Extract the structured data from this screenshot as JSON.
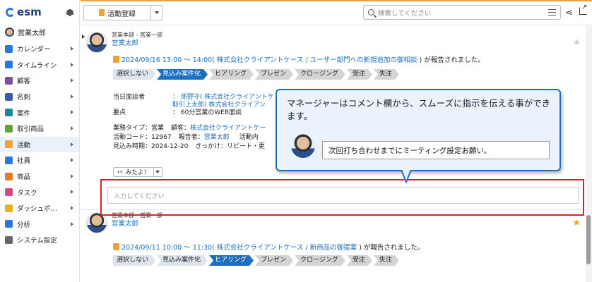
{
  "app": {
    "logo_text": "esm"
  },
  "user": {
    "name": "営業太郎"
  },
  "sidebar": {
    "items": [
      {
        "label": "カレンダー",
        "color": "#2a7ad5",
        "icon": "calendar-icon",
        "arrow": true
      },
      {
        "label": "タイムライン",
        "color": "#2a7ad5",
        "icon": "timeline-icon",
        "arrow": true
      },
      {
        "label": "顧客",
        "color": "#7b4fa0",
        "icon": "building-icon",
        "arrow": true
      },
      {
        "label": "名刺",
        "color": "#3b5aa8",
        "icon": "card-icon",
        "arrow": true
      },
      {
        "label": "案件",
        "color": "#1c8a9a",
        "icon": "case-icon",
        "arrow": true
      },
      {
        "label": "取引商品",
        "color": "#5fa33a",
        "icon": "product-icon",
        "arrow": true
      },
      {
        "label": "活動",
        "color": "#f0a23a",
        "icon": "activity-icon",
        "arrow": true,
        "active": true
      },
      {
        "label": "社員",
        "color": "#2a7ad5",
        "icon": "person-icon",
        "arrow": true
      },
      {
        "label": "商品",
        "color": "#e07b2e",
        "icon": "box-icon",
        "arrow": true
      },
      {
        "label": "タスク",
        "color": "#d6458a",
        "icon": "check-icon",
        "arrow": true
      },
      {
        "label": "ダッシュボ…",
        "color": "#e6b422",
        "icon": "dashboard-icon",
        "arrow": true
      },
      {
        "label": "分析",
        "color": "#2a7ad5",
        "icon": "chart-icon",
        "arrow": true
      },
      {
        "label": "システム設定",
        "color": "#666666",
        "icon": "gear-icon",
        "arrow": false
      }
    ]
  },
  "toolbar": {
    "register_label": "活動登録"
  },
  "search": {
    "placeholder": "検索してください"
  },
  "posts": [
    {
      "dept": "営業本部 - 営業一部",
      "author": "営業太郎",
      "message_date": "2024/09/16 13:00 ～ 14:00(",
      "message_link": "株式会社クライアントケース / ユーザー部門への新規追加の御相談",
      "message_suffix": ") が報告されました。",
      "steps": [
        "選択しない",
        "見込み案件化",
        "ヒアリング",
        "プレゼン",
        "クロージング",
        "受注",
        "失注"
      ],
      "current_step": 1,
      "attendees_label": "当日面談者",
      "attendees_1": "： 係野守( 株式会社クライアントケ",
      "attendees_2": "取引上太郎( 株式会社クライアン",
      "summary_label": "要点",
      "summary_value": "： 60分営業のWEB面談",
      "row1_a_label": "業務タイプ：",
      "row1_a_value": "営業",
      "row1_b_label": "顧客：",
      "row1_b_value": "株式会社クライアントケー",
      "row2_a_label": "活動コード：",
      "row2_a_value": "12967",
      "row2_b_label": "報告者：",
      "row2_b_value": "営業太郎",
      "row2_c_label": "活動内",
      "row3_a_label": "見込み時期：",
      "row3_a_value": "2024-12-20",
      "row3_b_label": "きっかけ：",
      "row3_b_value": "リピート・更",
      "like_label": "みたよ！",
      "comment_placeholder": "入力してください",
      "starred": false
    },
    {
      "dept": "営業本部 - 営業一部",
      "author": "営業太郎",
      "message_date": "2024/09/11 10:00 ～ 11:30(",
      "message_link": "株式会社クライアントケース / 新商品の御提案",
      "message_suffix": ") が報告されました。",
      "steps": [
        "選択しない",
        "見込み案件化",
        "ヒアリング",
        "プレゼン",
        "クロージング",
        "受注",
        "失注"
      ],
      "current_step": 2,
      "starred": true
    }
  ],
  "callout": {
    "text": "マネージャーはコメント欄から、スムーズに指示を伝える事ができます。",
    "comment": "次回打ち合わせまでにミーティング設定お願い。"
  },
  "colors": {
    "accent": "#1d6fbf",
    "highlight": "#d6242a",
    "brand_orange": "#f0a23a"
  }
}
